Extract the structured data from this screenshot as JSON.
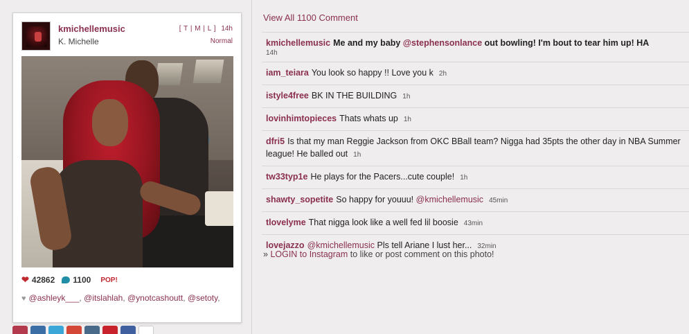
{
  "post": {
    "username": "kmichellemusic",
    "full_name": "K. Michelle",
    "view_modes": "[ T | M | L ]",
    "time": "14h",
    "filter": "Normal",
    "likes": "42862",
    "comments_count": "1100",
    "pop_label": "POP!",
    "likers": [
      "@ashleyk___",
      "@itslahlah",
      "@ynotcashoutt",
      "@setoty"
    ]
  },
  "comments_panel": {
    "view_all": "View All 1100 Comment",
    "items": [
      {
        "user": "kmichellemusic",
        "parts": [
          "Me and my baby ",
          "@stephensonlance",
          " out bowling! I'm bout to tear him up! HA"
        ],
        "time": "14h"
      },
      {
        "user": "iam_teiara",
        "parts": [
          "You look so happy !! Love you k",
          "",
          ""
        ],
        "time": "2h"
      },
      {
        "user": "istyle4free",
        "parts": [
          "BK IN THE BUILDING",
          "",
          ""
        ],
        "time": "1h"
      },
      {
        "user": "lovinhimtopieces",
        "parts": [
          "Thats whats up",
          "",
          ""
        ],
        "time": "1h"
      },
      {
        "user": "dfri5",
        "parts": [
          "Is that my man Reggie Jackson from OKC BBall team? Nigga had 35pts the other day in NBA Summer league! He balled out",
          "",
          ""
        ],
        "time": "1h"
      },
      {
        "user": "tw33typ1e",
        "parts": [
          "He plays for the Pacers...cute couple!",
          "",
          ""
        ],
        "time": "1h"
      },
      {
        "user": "shawty_sopetite",
        "parts": [
          "So happy for youuu! ",
          "@kmichellemusic",
          ""
        ],
        "time": "45min"
      },
      {
        "user": "tlovelyme",
        "parts": [
          "That nigga look like a well fed lil boosie",
          "",
          ""
        ],
        "time": "43min"
      },
      {
        "user": "lovejazzo",
        "parts": [
          "",
          "@kmichellemusic",
          " Pls tell Ariane I lust her..."
        ],
        "time": "32min"
      }
    ],
    "login_prefix": "» ",
    "login_link": "LOGIN to Instagram",
    "login_suffix": " to like or post comment on this photo!"
  },
  "colors": {
    "accent": "#8b2f51",
    "heart": "#c0282f",
    "bubble": "#1f8ea6",
    "background": "#efeded"
  },
  "icons": [
    "heart-icon",
    "comment-bubble-icon",
    "share-icons"
  ]
}
